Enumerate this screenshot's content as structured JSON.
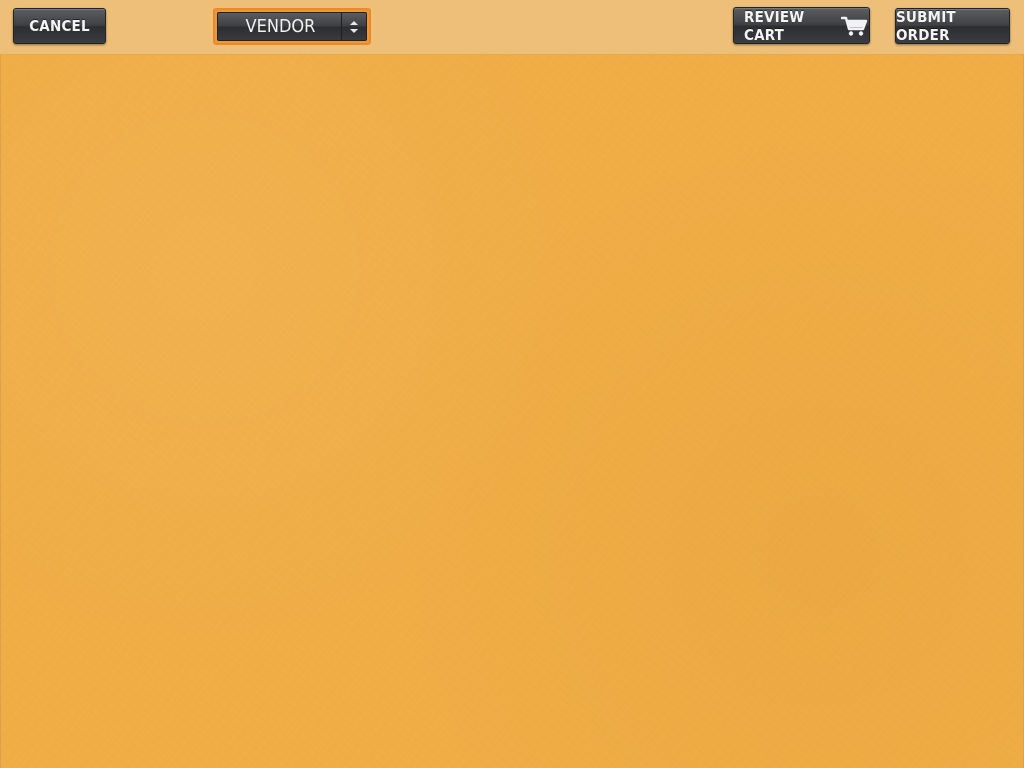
{
  "toolbar": {
    "cancel_label": "Cancel",
    "vendor_select": {
      "selected": "Vendor"
    },
    "review_cart_label": "Review Cart",
    "review_cart_icon": "cart-icon",
    "submit_order_label": "Submit Order"
  },
  "colors": {
    "background": "#f0ad46",
    "toolbar": "#eebf78",
    "button": "#3e4044",
    "button_text": "#f4f4f4",
    "select_highlight": "#ec8a2a"
  }
}
